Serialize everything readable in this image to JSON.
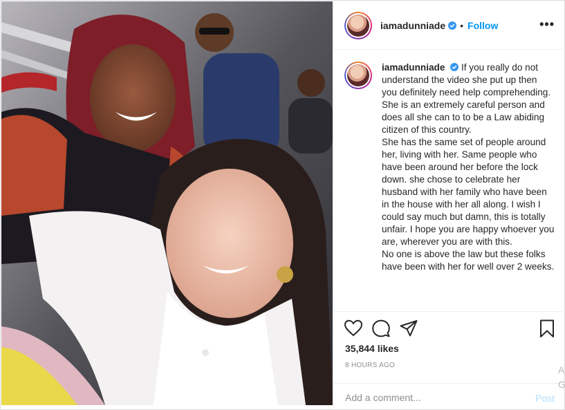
{
  "post": {
    "username": "iamadunniade",
    "separator": "•",
    "follow_label": "Follow",
    "more_label": "•••",
    "caption": {
      "username": "iamadunniade",
      "paragraphs": [
        "If you really do not understand the video she put up then you definitely need help comprehending. She is an extremely careful person and does all she can to to be a Law abiding citizen of this country.",
        "She has the same set of people around her, living with her. Same people who have been around her before the lock down. she chose to celebrate her husband with her family who have been in the house with her all along. I wish I could say much but damn, this is totally unfair. I hope you are happy whoever you are, wherever you are with this.",
        "No one is above the law but these folks have been with her for well over 2 weeks."
      ]
    },
    "likes": "35,844 likes",
    "timestamp": "8 HOURS AGO",
    "comment_placeholder": "Add a comment...",
    "post_label": "Post",
    "colors": {
      "link_blue": "#0095f6",
      "post_disabled": "#b2dffc",
      "muted": "#8e8e8e",
      "border": "#efefef"
    },
    "icons": [
      "verified-badge-icon",
      "heart-icon",
      "comment-icon",
      "share-icon",
      "bookmark-icon",
      "more-options-icon"
    ]
  },
  "edge": {
    "line1": "A",
    "line2": "G"
  }
}
